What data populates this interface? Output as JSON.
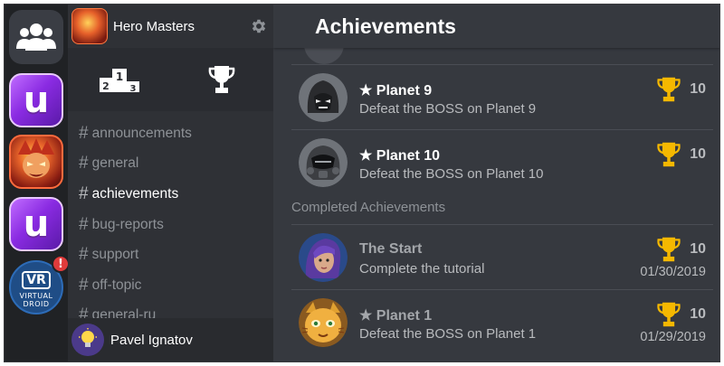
{
  "icons": {
    "friends": "people-group-icon",
    "settings": "gear-icon",
    "leaderboard": "podium-icon",
    "trophy": "trophy-icon",
    "star": "star-icon"
  },
  "colors": {
    "rail_bg": "#202225",
    "panel_bg": "#2f3136",
    "main_bg": "#36393f",
    "trophy_gold": "#f5b800",
    "badge_red": "#e03b3b"
  },
  "rail": {
    "vr_label": "VR",
    "vr_caption_1": "VIRTUAL",
    "vr_caption_2": "DROID",
    "vr_badge": "!",
    "u_letter": "u"
  },
  "server": {
    "name": "Hero Masters"
  },
  "tabs": {
    "podium_digits": [
      "1",
      "2",
      "3"
    ]
  },
  "channels": [
    {
      "hash": "#",
      "name": "announcements",
      "active": false
    },
    {
      "hash": "#",
      "name": "general",
      "active": false
    },
    {
      "hash": "#",
      "name": "achievements",
      "active": true
    },
    {
      "hash": "#",
      "name": "bug-reports",
      "active": false
    },
    {
      "hash": "#",
      "name": "support",
      "active": false
    },
    {
      "hash": "#",
      "name": "off-topic",
      "active": false
    },
    {
      "hash": "#",
      "name": "general-ru",
      "active": false
    }
  ],
  "user": {
    "name": "Pavel Ignatov"
  },
  "main": {
    "title": "Achievements",
    "section_completed": "Completed Achievements",
    "locked": [
      {
        "title": "★ Planet 9",
        "desc": "Defeat the BOSS on Planet 9",
        "points": "10"
      },
      {
        "title": "★ Planet 10",
        "desc": "Defeat the BOSS on Planet 10",
        "points": "10"
      }
    ],
    "completed": [
      {
        "title": "The Start",
        "desc": "Complete the tutorial",
        "points": "10",
        "date": "01/30/2019"
      },
      {
        "title": "★ Planet 1",
        "desc": "Defeat the BOSS on Planet 1",
        "points": "10",
        "date": "01/29/2019"
      }
    ]
  }
}
